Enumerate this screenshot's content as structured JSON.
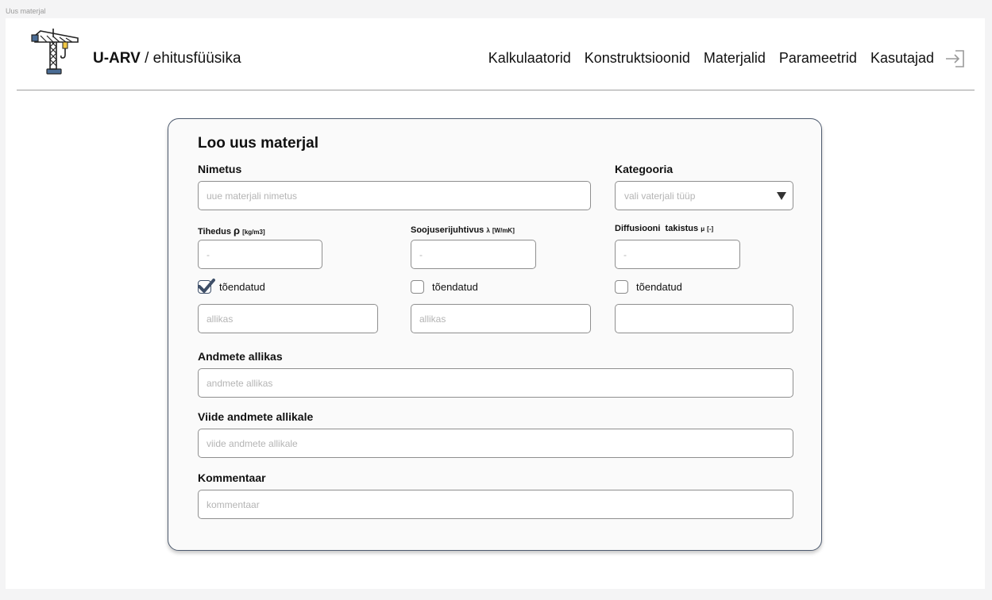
{
  "frame_label": "Uus materjal",
  "brand": {
    "name": "U-ARV",
    "separator": " / ",
    "subtitle": "ehitusfüüsika"
  },
  "nav": {
    "items": [
      "Kalkulaatorid",
      "Konstruktsioonid",
      "Materjalid",
      "Parameetrid",
      "Kasutajad"
    ],
    "logout_icon": "logout-icon"
  },
  "form": {
    "title": "Loo uus materjal",
    "name": {
      "label": "Nimetus",
      "placeholder": "uue materjali nimetus"
    },
    "category": {
      "label": "Kategooria",
      "placeholder": "vali vaterjali tüüp"
    },
    "density": {
      "label": "Tihedus",
      "symbol": "ρ",
      "unit": "[kg/m3]",
      "placeholder": "-"
    },
    "conductivity": {
      "label": "Soojuserijuhtivus",
      "symbol": "λ",
      "unit": "[W/mK]",
      "placeholder": "-"
    },
    "diffusion": {
      "label": "Diffusiooni  takistus",
      "symbol": "μ",
      "unit": "[-]",
      "placeholder": "-"
    },
    "verified": [
      {
        "label": "tõendatud",
        "checked": true,
        "source_placeholder": "allikas"
      },
      {
        "label": "tõendatud",
        "checked": false,
        "source_placeholder": "allikas"
      },
      {
        "label": "tõendatud",
        "checked": false,
        "source_placeholder": ""
      }
    ],
    "data_source": {
      "label": "Andmete allikas",
      "placeholder": "andmete allikas"
    },
    "reference": {
      "label": "Viide andmete allikale",
      "placeholder": "viide andmete allikale"
    },
    "comment": {
      "label": "Kommentaar",
      "placeholder": "kommentaar"
    }
  },
  "colors": {
    "checkbox_checked": "#3e4f68",
    "card_border": "#4d5a6e",
    "logo_blue": "#4a6c95"
  }
}
